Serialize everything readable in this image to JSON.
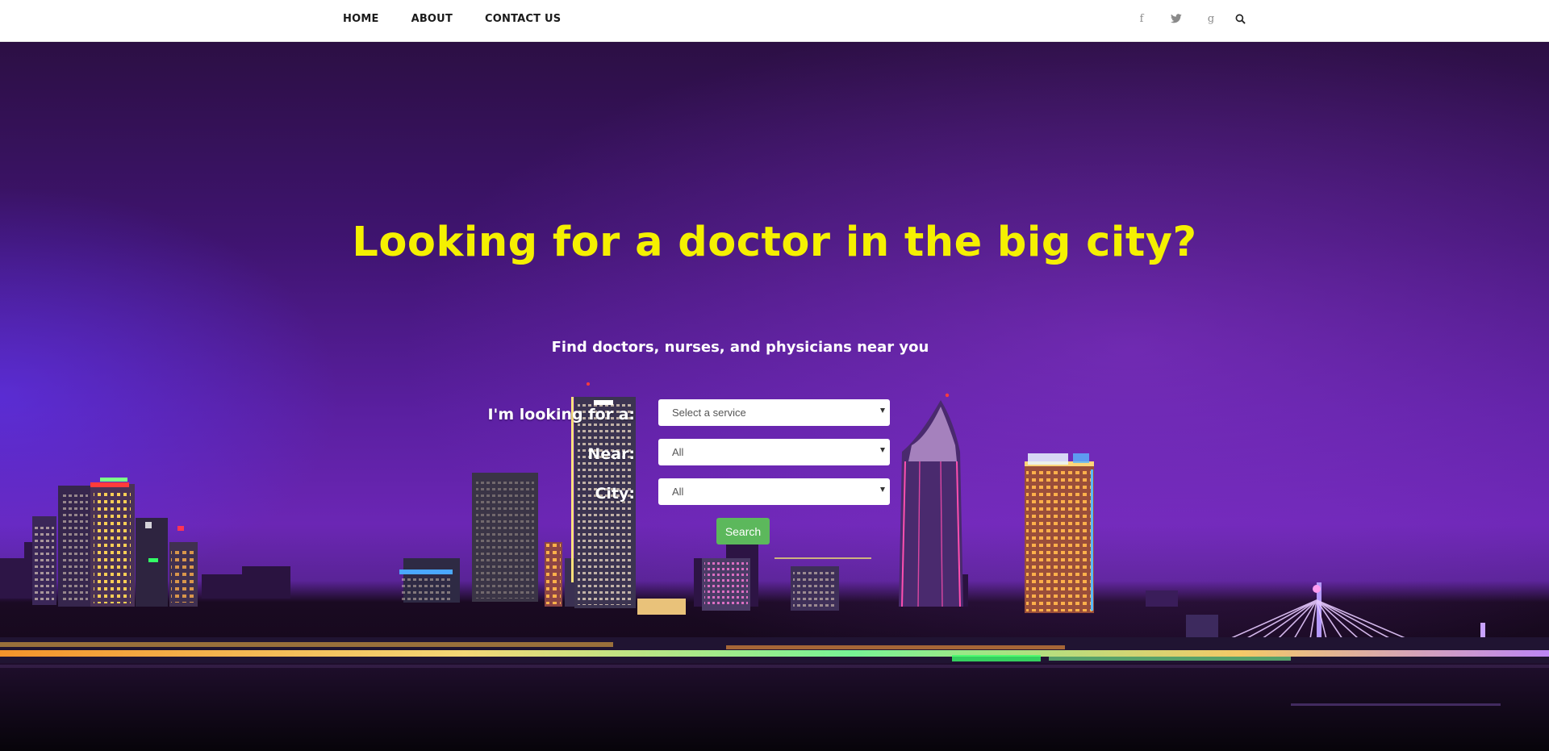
{
  "nav": {
    "links": [
      "HOME",
      "ABOUT",
      "CONTACT US"
    ]
  },
  "social": {
    "icons": [
      "facebook-icon",
      "twitter-icon",
      "google-plus-icon",
      "search-icon"
    ],
    "glyphs": {
      "facebook": "f",
      "google": "g"
    },
    "icon_color": "#8a8a8a"
  },
  "hero": {
    "headline": "Looking for a doctor in the big city?",
    "subheadline": "Find doctors, nurses, and physicians near you",
    "headline_color": "#f5f000"
  },
  "form": {
    "service_label": "I'm looking for a:",
    "service_value": "Select a service",
    "near_label": "Near:",
    "near_value": "All",
    "city_label": "City:",
    "city_value": "All",
    "search_label": "Search",
    "search_color": "#5cb85c"
  }
}
